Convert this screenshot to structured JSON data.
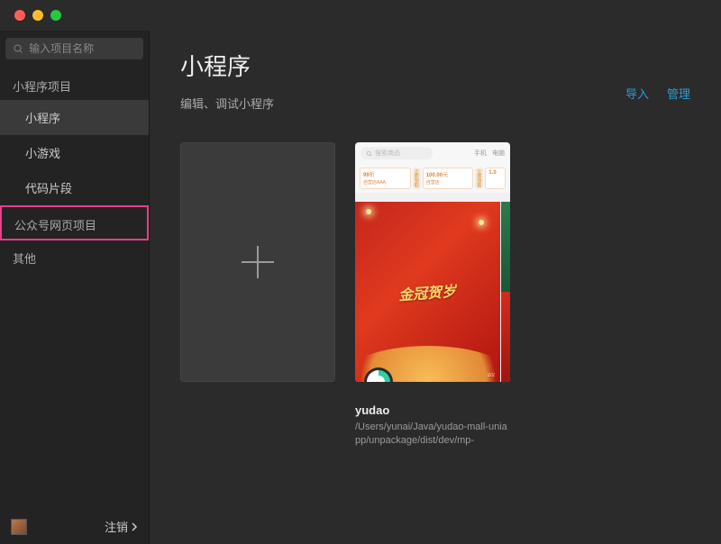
{
  "search": {
    "placeholder": "输入项目名称"
  },
  "sidebar": {
    "section1_label": "小程序项目",
    "items": [
      {
        "label": "小程序",
        "active": true
      },
      {
        "label": "小游戏",
        "active": false
      },
      {
        "label": "代码片段",
        "active": false
      }
    ],
    "section2_label": "公众号网页项目",
    "section3_label": "其他",
    "logout_label": "注销"
  },
  "main": {
    "title": "小程序",
    "subtitle": "编辑、调试小程序"
  },
  "actions": {
    "import_label": "导入",
    "manage_label": "管理"
  },
  "project": {
    "name": "yudao",
    "path": "/Users/yunai/Java/yudao-mall-uniapp/unpackage/dist/dev/mp-"
  },
  "preview": {
    "search_placeholder": "搜索商品",
    "tab_phone": "手机",
    "tab_pc": "电脑",
    "coupon1_price": "99",
    "coupon1_unit": "折",
    "coupon1_btn": "立即领取",
    "coupon2_price": "100.00",
    "coupon2_unit": "元",
    "coupon2_btn": "立即领取",
    "banner_text": "金冠贺岁"
  }
}
